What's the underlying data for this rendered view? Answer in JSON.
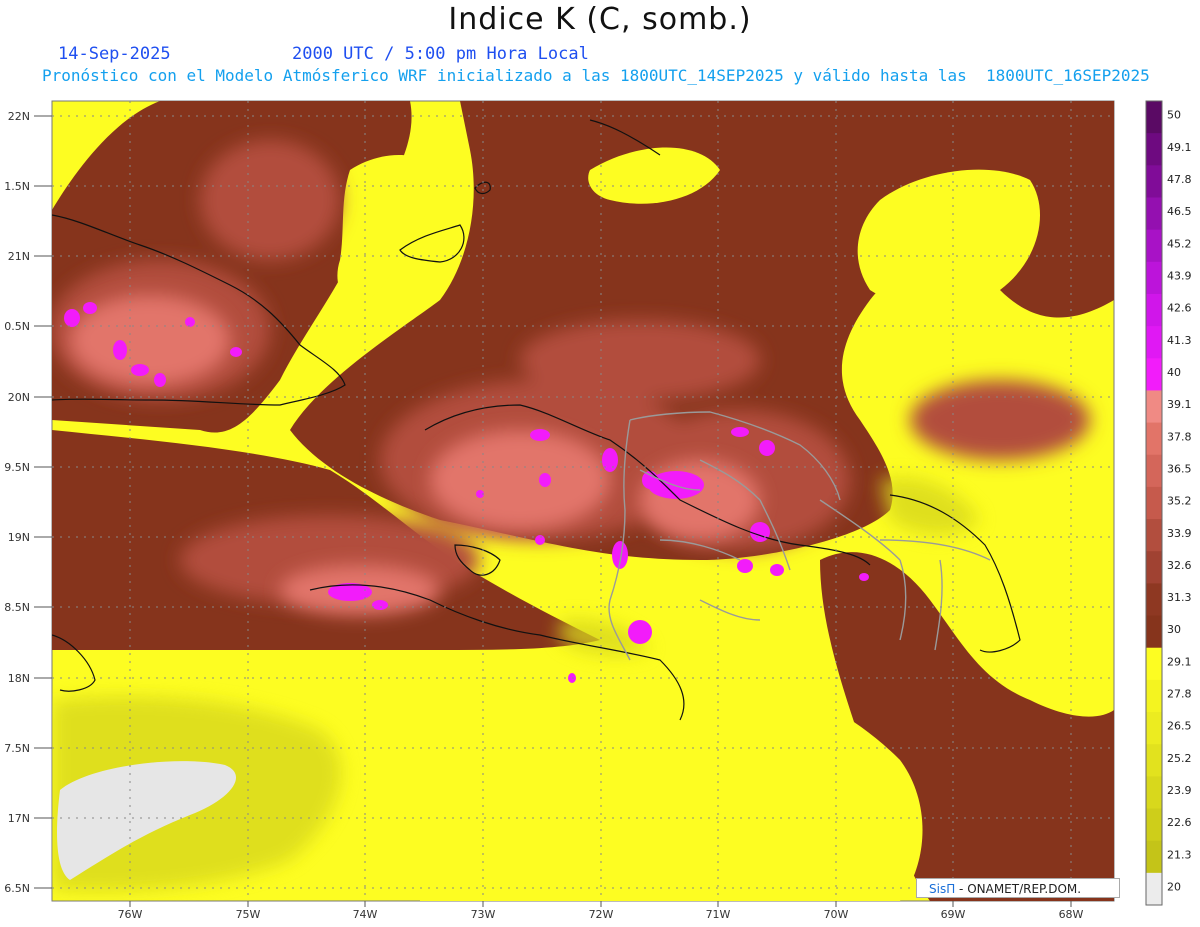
{
  "header": {
    "title": "Indice K (C, somb.)",
    "date": "14-Sep-2025",
    "time": "2000 UTC / 5:00 pm Hora Local",
    "model_info": "Pronóstico con el Modelo Atmósferico WRF inicializado a las 1800UTC_14SEP2025 y válido hasta las  1800UTC_16SEP2025"
  },
  "axes": {
    "lat_labels": [
      "22N",
      "1.5N",
      "21N",
      "0.5N",
      "20N",
      "9.5N",
      "19N",
      "8.5N",
      "18N",
      "7.5N",
      "17N",
      "6.5N"
    ],
    "lon_labels": [
      "76W",
      "75W",
      "74W",
      "73W",
      "72W",
      "71W",
      "70W",
      "69W",
      "68W"
    ]
  },
  "colorbar": {
    "labels": [
      "50",
      "49.1",
      "47.8",
      "46.5",
      "45.2",
      "43.9",
      "42.6",
      "41.3",
      "40",
      "39.1",
      "37.8",
      "36.5",
      "35.2",
      "33.9",
      "32.6",
      "31.3",
      "30",
      "29.1",
      "27.8",
      "26.5",
      "25.2",
      "23.9",
      "22.6",
      "21.3",
      "20"
    ],
    "colors": [
      "#5a0a64",
      "#6e0a80",
      "#800c98",
      "#9410b0",
      "#a812c6",
      "#bc14da",
      "#d016ea",
      "#e018f4",
      "#f21cfa",
      "#f08a84",
      "#e27468",
      "#d4665a",
      "#c65a4c",
      "#b24e3e",
      "#a04232",
      "#8e3822",
      "#86341c",
      "#fdfd22",
      "#f4f420",
      "#ecec20",
      "#e2e21e",
      "#d8d81c",
      "#cece1a",
      "#c4c418",
      "#ececec"
    ]
  },
  "credit": {
    "logo": "SisΠ",
    "text": " - ONAMET/REP.DOM."
  }
}
